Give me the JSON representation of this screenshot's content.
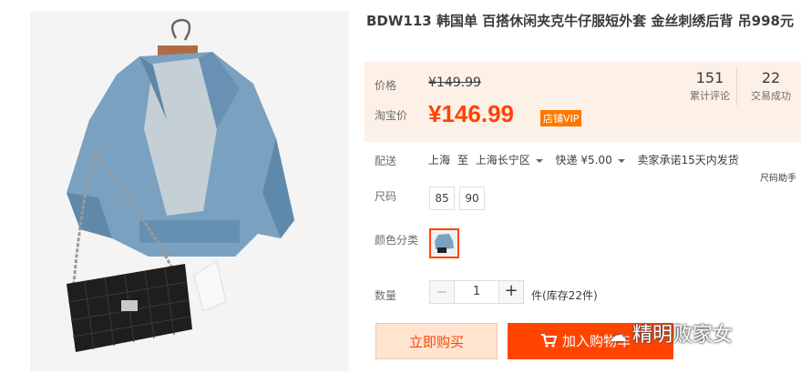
{
  "product": {
    "title": "BDW113 韩国单 百搭休闲夹克牛仔服短外套 金丝刺绣后背 吊998元"
  },
  "price": {
    "original_label": "价格",
    "original_value": "¥149.99",
    "sale_label": "淘宝价",
    "sale_value": "¥146.99",
    "vip_badge": "店铺VIP"
  },
  "stats": [
    {
      "number": "151",
      "label": "累计评论"
    },
    {
      "number": "22",
      "label": "交易成功"
    }
  ],
  "delivery": {
    "label": "配送",
    "from": "上海",
    "to_word": "至",
    "to": "上海长宁区",
    "shipping": "快递 ¥5.00",
    "promise": "卖家承诺15天内发货",
    "size_helper": "尺码助手"
  },
  "size": {
    "label": "尺码",
    "options": [
      "85",
      "90"
    ]
  },
  "color": {
    "label": "颜色分类"
  },
  "quantity": {
    "label": "数量",
    "value": "1",
    "minus": "−",
    "plus": "+",
    "stock": "件(库存22件)"
  },
  "buttons": {
    "buy_now": "立即购买",
    "add_cart": "加入购物车"
  },
  "watermark": "精明败家女",
  "colors": {
    "accent": "#ff4400",
    "price_bg": "#fdf0e6"
  }
}
